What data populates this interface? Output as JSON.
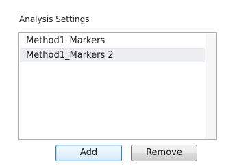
{
  "analysis_settings": {
    "title": "Analysis Settings",
    "items": [
      {
        "label": "Method1_Markers",
        "selected": false
      },
      {
        "label": "Method1_Markers 2",
        "selected": true
      }
    ]
  },
  "buttons": {
    "add_label": "Add",
    "remove_label": "Remove"
  },
  "colors": {
    "selected_row_bg": "#eceef1",
    "default_button_border": "#3c7fb1",
    "list_border": "#abadb3"
  }
}
